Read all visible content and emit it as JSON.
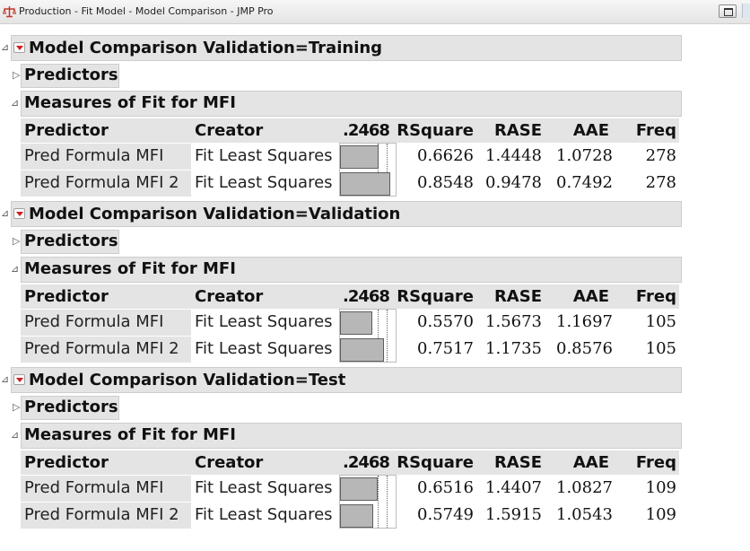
{
  "window": {
    "title": "Production - Fit Model - Model Comparison - JMP Pro",
    "app_icon": "jmp-scale-icon"
  },
  "column_headers": {
    "predictor": "Predictor",
    "creator": "Creator",
    "bar_scale": ".2468",
    "rsquare": "RSquare",
    "rase": "RASE",
    "aae": "AAE",
    "freq": "Freq"
  },
  "sections": [
    {
      "title": "Model Comparison Validation=Training",
      "predictors_label": "Predictors",
      "fit_title": "Measures of Fit for MFI",
      "rows": [
        {
          "predictor": "Pred Formula MFI",
          "creator": "Fit Least Squares",
          "rsquare_value": 0.6626,
          "rsquare": "0.6626",
          "rase": "1.4448",
          "aae": "1.0728",
          "freq": "278"
        },
        {
          "predictor": "Pred Formula MFI 2",
          "creator": "Fit Least Squares",
          "rsquare_value": 0.8548,
          "rsquare": "0.8548",
          "rase": "0.9478",
          "aae": "0.7492",
          "freq": "278"
        }
      ]
    },
    {
      "title": "Model Comparison Validation=Validation",
      "predictors_label": "Predictors",
      "fit_title": "Measures of Fit for MFI",
      "rows": [
        {
          "predictor": "Pred Formula MFI",
          "creator": "Fit Least Squares",
          "rsquare_value": 0.557,
          "rsquare": "0.5570",
          "rase": "1.5673",
          "aae": "1.1697",
          "freq": "105"
        },
        {
          "predictor": "Pred Formula MFI 2",
          "creator": "Fit Least Squares",
          "rsquare_value": 0.7517,
          "rsquare": "0.7517",
          "rase": "1.1735",
          "aae": "0.8576",
          "freq": "105"
        }
      ]
    },
    {
      "title": "Model Comparison Validation=Test",
      "predictors_label": "Predictors",
      "fit_title": "Measures of Fit for MFI",
      "rows": [
        {
          "predictor": "Pred Formula MFI",
          "creator": "Fit Least Squares",
          "rsquare_value": 0.6516,
          "rsquare": "0.6516",
          "rase": "1.4407",
          "aae": "1.0827",
          "freq": "109"
        },
        {
          "predictor": "Pred Formula MFI 2",
          "creator": "Fit Least Squares",
          "rsquare_value": 0.5749,
          "rsquare": "0.5749",
          "rase": "1.5915",
          "aae": "1.0543",
          "freq": "109"
        }
      ]
    }
  ],
  "colors": {
    "header_bg": "#e4e4e4",
    "red_triangle": "#d21d1d",
    "bar_fill": "#b7b7b7"
  }
}
